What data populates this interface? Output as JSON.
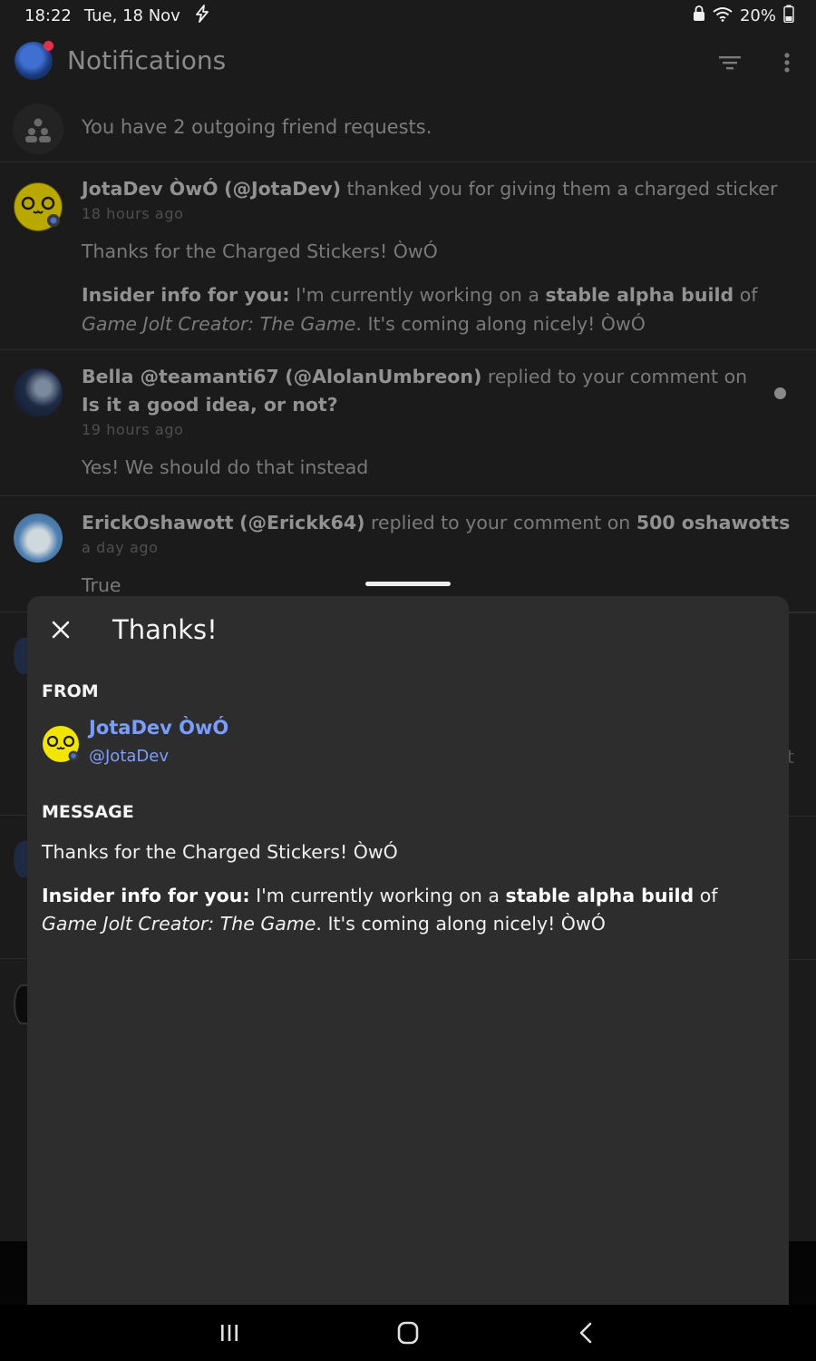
{
  "status_bar": {
    "time": "18:22",
    "date": "Tue, 18 Nov",
    "battery": "20%"
  },
  "header": {
    "title": "Notifications"
  },
  "friend_requests": {
    "text": "You have 2 outgoing friend requests."
  },
  "notifications": [
    {
      "user": "JotaDev ÒwÓ",
      "handle": "(@JotaDev)",
      "action": "thanked you for giving them a charged sticker",
      "time": "18 hours ago",
      "message": "Thanks for the Charged Stickers! ÒwÓ",
      "insider_label": "Insider info for you:",
      "insider_text1": "I'm currently working on a",
      "insider_bold": "stable alpha build",
      "insider_text2": "of",
      "insider_italic1": "Game Jolt Creator: The Game",
      "insider_text3": ". It's coming along nicely! ÒwÓ"
    },
    {
      "user": "Bella @teamanti67",
      "handle": "(@AlolanUmbreon)",
      "action": "replied to your comment on",
      "target": "Is it a good idea, or not?",
      "time": "19 hours ago",
      "message": "Yes! We should do that instead"
    },
    {
      "user": "ErickOshawott",
      "handle": "(@Erickk64)",
      "action": "replied to your comment on",
      "target": "500 oshawotts",
      "time": "a day ago",
      "message": "True"
    }
  ],
  "sheet": {
    "title": "Thanks!",
    "from_label": "FROM",
    "sender_name": "JotaDev ÒwÓ",
    "sender_handle": "@JotaDev",
    "message_label": "MESSAGE",
    "message": "Thanks for the Charged Stickers! ÒwÓ",
    "insider_label": "Insider info for you:",
    "insider_text1": "I'm currently working on a",
    "insider_bold": "stable alpha build",
    "insider_text2": "of",
    "insider_italic1": "Game Jolt Creator: The Game",
    "insider_text3": ". It's coming along nicely! ÒwÓ"
  },
  "side_clip_char": "t",
  "icons": {
    "charging": "lightning-icon",
    "wifi": "wifi-icon",
    "battery": "battery-icon",
    "filter": "filter-icon",
    "more": "more-vertical-icon",
    "friends": "friends-icon",
    "close": "close-icon"
  },
  "colors": {
    "background": "#1b1b1b",
    "sheet": "#2d2d2d",
    "link": "#7b9dff",
    "badge": "#e0324a"
  }
}
